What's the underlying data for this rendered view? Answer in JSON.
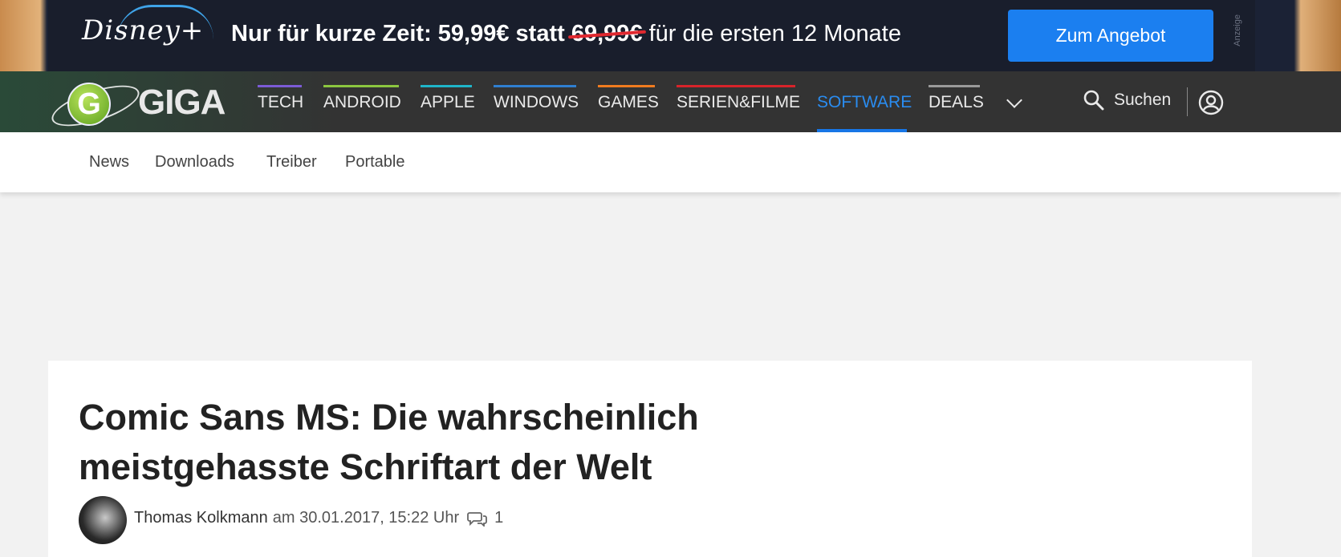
{
  "ad": {
    "brand": "Disney+",
    "headline_prefix": "Nur für kurze Zeit: 59,99€ statt ",
    "old_price": "69,99€",
    "headline_suffix": " für die ersten 12 Monate",
    "cta": "Zum Angebot",
    "label": "Anzeige"
  },
  "nav": {
    "logo": "GIGA",
    "items": [
      {
        "label": "TECH",
        "color": "#7b5bd6"
      },
      {
        "label": "ANDROID",
        "color": "#8cc63f"
      },
      {
        "label": "APPLE",
        "color": "#1fb5c9"
      },
      {
        "label": "WINDOWS",
        "color": "#2f7fd1"
      },
      {
        "label": "GAMES",
        "color": "#f07b1f"
      },
      {
        "label": "SERIEN&FILME",
        "color": "#d8232a"
      },
      {
        "label": "SOFTWARE",
        "color": "#1877e8"
      },
      {
        "label": "DEALS",
        "color": "#9a9a9a"
      }
    ],
    "active": "SOFTWARE",
    "search_label": "Suchen"
  },
  "subnav": {
    "items": [
      "News",
      "Downloads",
      "Treiber",
      "Portable"
    ]
  },
  "article": {
    "title_line1": "Comic Sans MS: Die wahrscheinlich",
    "title_line2": "meistgehasste Schriftart der Welt",
    "author": "Thomas Kolkmann",
    "date": "am 30.01.2017, 15:22 Uhr",
    "comments": "1"
  }
}
